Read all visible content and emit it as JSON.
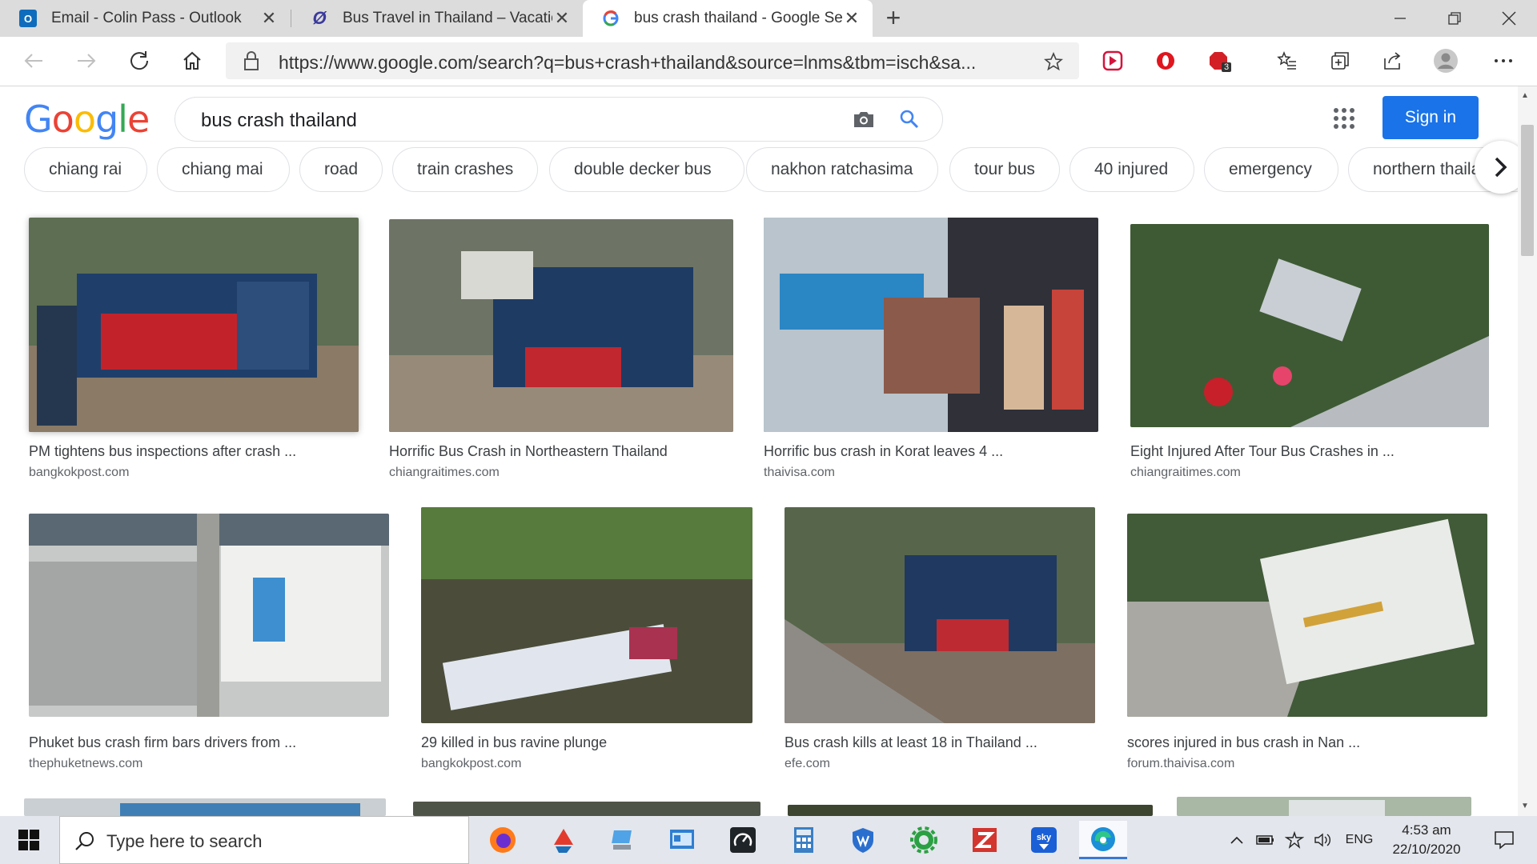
{
  "browser": {
    "tabs": [
      {
        "title": "Email - Colin Pass - Outlook",
        "icon": "outlook-icon"
      },
      {
        "title": "Bus Travel in Thailand – Vacation",
        "icon": "site-icon"
      },
      {
        "title": "bus crash thailand - Google Sear",
        "icon": "google-icon"
      }
    ],
    "url": "https://www.google.com/search?q=bus+crash+thailand&source=lnms&tbm=isch&sa...",
    "extension_badge": "3"
  },
  "google": {
    "logo": "Google",
    "query": "bus crash thailand",
    "sign_in": "Sign in",
    "chips": [
      "chiang rai",
      "chiang mai",
      "road",
      "train crashes",
      "double decker bus",
      "nakhon ratchasima",
      "tour bus",
      "40 injured",
      "emergency",
      "northern thaila"
    ]
  },
  "results": [
    {
      "title": "PM tightens bus inspections after crash ...",
      "source": "bangkokpost.com"
    },
    {
      "title": "Horrific Bus Crash in Northeastern Thailand",
      "source": "chiangraitimes.com"
    },
    {
      "title": "Horrific bus crash in Korat leaves 4 ...",
      "source": "thaivisa.com"
    },
    {
      "title": "Eight Injured After Tour Bus Crashes in ...",
      "source": "chiangraitimes.com"
    },
    {
      "title": "Phuket bus crash firm bars drivers from ...",
      "source": "thephuketnews.com"
    },
    {
      "title": "29 killed in bus ravine plunge",
      "source": "bangkokpost.com"
    },
    {
      "title": "Bus crash kills at least 18 in Thailand ...",
      "source": "efe.com"
    },
    {
      "title": "scores injured in bus crash in Nan ...",
      "source": "forum.thaivisa.com"
    }
  ],
  "taskbar": {
    "search_placeholder": "Type here to search",
    "language": "ENG",
    "time": "4:53 am",
    "date": "22/10/2020"
  },
  "colors": {
    "accent": "#1a73e8",
    "taskbar": "#e3e6ec",
    "tabstrip": "#dcdcdc"
  }
}
